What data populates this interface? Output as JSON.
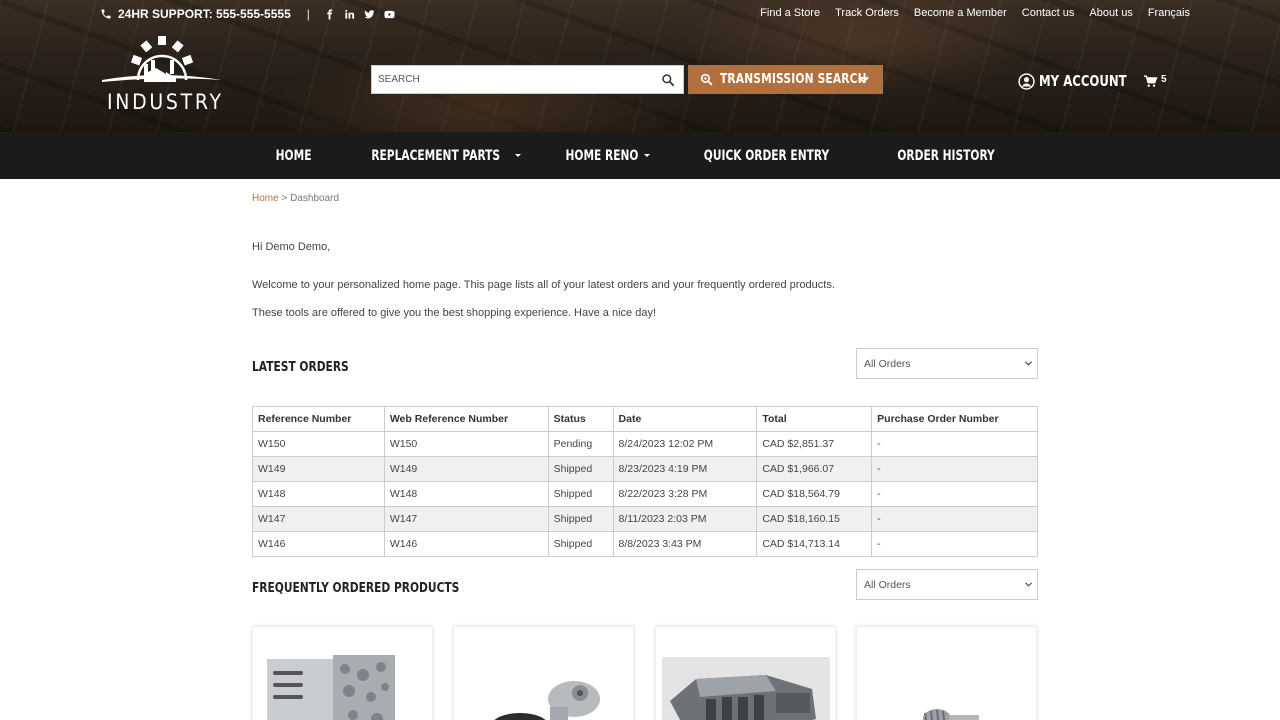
{
  "topbar": {
    "support": "24HR SUPPORT: 555-555-5555",
    "separator": "|",
    "social_icons": [
      "facebook-icon",
      "linkedin-icon",
      "twitter-icon",
      "youtube-icon"
    ],
    "links": [
      "Find a Store",
      "Track Orders",
      "Become a Member",
      "Contact us",
      "About us",
      "Français"
    ]
  },
  "logo": {
    "text": "INDUSTRY"
  },
  "search": {
    "placeholder": "SEARCH"
  },
  "transmission_button": {
    "label": "TRANSMISSION SEARCH"
  },
  "account": {
    "label": "MY ACCOUNT"
  },
  "cart": {
    "count": "5"
  },
  "nav": {
    "items": [
      {
        "label": "HOME",
        "dropdown": false
      },
      {
        "label": "REPLACEMENT PARTS",
        "dropdown": true
      },
      {
        "label": "HOME RENO",
        "dropdown": true
      },
      {
        "label": "QUICK ORDER ENTRY",
        "dropdown": false
      },
      {
        "label": "ORDER HISTORY",
        "dropdown": false
      }
    ]
  },
  "breadcrumb": {
    "home": "Home",
    "separator": ">",
    "current": "Dashboard"
  },
  "greeting": "Hi Demo Demo,",
  "intro": {
    "p1": "Welcome to your personalized home page. This page lists all of your latest orders and your frequently ordered products.",
    "p2": "These tools are offered to give you the best shopping experience. Have a nice day!"
  },
  "latest_orders": {
    "title": "LATEST ORDERS",
    "filter": "All Orders",
    "columns": [
      "Reference Number",
      "Web Reference Number",
      "Status",
      "Date",
      "Total",
      "Purchase Order Number"
    ],
    "rows": [
      [
        "W150",
        "W150",
        "Pending",
        "8/24/2023 12:02 PM",
        "CAD $2,851.37",
        "-"
      ],
      [
        "W149",
        "W149",
        "Shipped",
        "8/23/2023 4:19 PM",
        "CAD $1,966.07",
        "-"
      ],
      [
        "W148",
        "W148",
        "Shipped",
        "8/22/2023 3:28 PM",
        "CAD $18,564.79",
        "-"
      ],
      [
        "W147",
        "W147",
        "Shipped",
        "8/11/2023 2:03 PM",
        "CAD $18,160.15",
        "-"
      ],
      [
        "W146",
        "W146",
        "Shipped",
        "8/8/2023 3:43 PM",
        "CAD $14,713.14",
        "-"
      ]
    ]
  },
  "frequent_products": {
    "title": "FREQUENTLY ORDERED PRODUCTS",
    "filter": "All Orders"
  },
  "colors": {
    "accent": "#b0703f",
    "nav_bg": "#1b1b1b",
    "header_bg": "#2a211a",
    "row_alt": "#f0f0f0"
  }
}
